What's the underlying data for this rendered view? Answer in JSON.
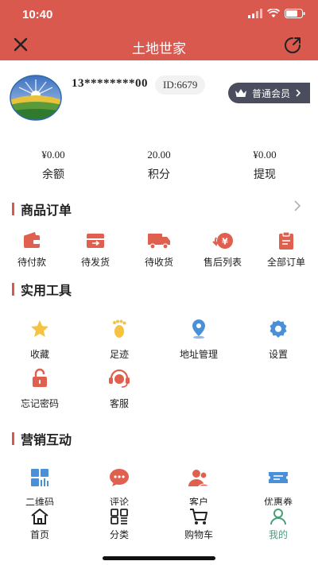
{
  "status_bar": {
    "time": "10:40"
  },
  "nav": {
    "title": "土地世家"
  },
  "profile": {
    "phone": "13********00",
    "id": "ID:6679",
    "member_level": "普通会员"
  },
  "stats": [
    {
      "value": "¥0.00",
      "label": "余额"
    },
    {
      "value": "20.00",
      "label": "积分"
    },
    {
      "value": "¥0.00",
      "label": "提现"
    }
  ],
  "orders": {
    "title": "商品订单",
    "items": [
      {
        "label": "待付款",
        "icon": "wallet-icon"
      },
      {
        "label": "待发货",
        "icon": "box-icon"
      },
      {
        "label": "待收货",
        "icon": "truck-icon"
      },
      {
        "label": "售后列表",
        "icon": "refund-icon"
      },
      {
        "label": "全部订单",
        "icon": "clipboard-icon"
      }
    ]
  },
  "tools": {
    "title": "实用工具",
    "items": [
      {
        "label": "收藏",
        "icon": "star-icon"
      },
      {
        "label": "足迹",
        "icon": "footprint-icon"
      },
      {
        "label": "地址管理",
        "icon": "location-icon"
      },
      {
        "label": "设置",
        "icon": "gear-icon"
      },
      {
        "label": "忘记密码",
        "icon": "lock-icon"
      },
      {
        "label": "客服",
        "icon": "headset-icon"
      }
    ]
  },
  "marketing": {
    "title": "营销互动",
    "items": [
      {
        "label": "二维码",
        "icon": "qrcode-icon"
      },
      {
        "label": "评论",
        "icon": "comment-icon"
      },
      {
        "label": "客户",
        "icon": "users-icon"
      },
      {
        "label": "优惠券",
        "icon": "coupon-icon"
      }
    ]
  },
  "tabbar": {
    "items": [
      {
        "label": "首页",
        "icon": "home-icon"
      },
      {
        "label": "分类",
        "icon": "category-icon"
      },
      {
        "label": "购物车",
        "icon": "cart-icon"
      },
      {
        "label": "我的",
        "icon": "profile-icon"
      }
    ]
  },
  "colors": {
    "header": "#d9594f",
    "accent_red": "#e0604f",
    "icon_blue": "#4a90d9",
    "icon_yellow": "#f5c242",
    "member_badge": "#4a4d5e",
    "tab_active": "#4a9e7a"
  }
}
